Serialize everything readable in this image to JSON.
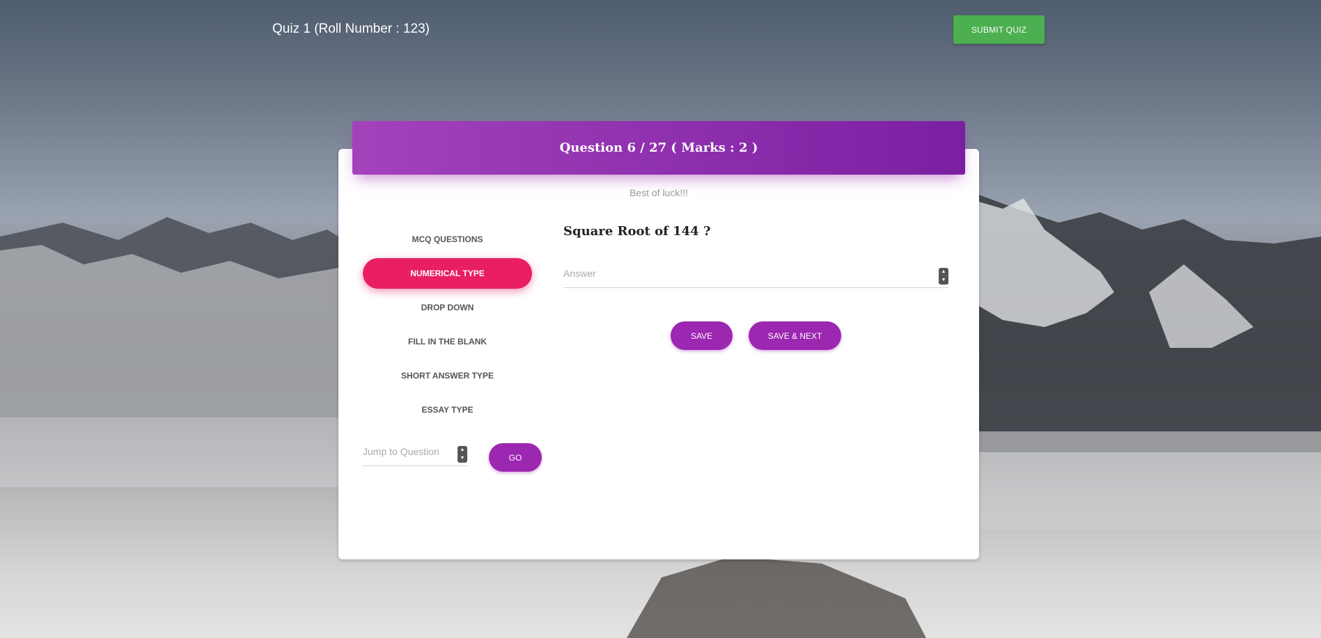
{
  "topbar": {
    "title": "Quiz 1 (Roll Number : 123)",
    "submit_label": "SUBMIT QUIZ"
  },
  "card": {
    "header": "Question 6 / 27 ( Marks : 2 )",
    "subtitle": "Best of luck!!!"
  },
  "nav": {
    "items": [
      {
        "label": "MCQ QUESTIONS",
        "active": false
      },
      {
        "label": "NUMERICAL TYPE",
        "active": true
      },
      {
        "label": "DROP DOWN",
        "active": false
      },
      {
        "label": "FILL IN THE BLANK",
        "active": false
      },
      {
        "label": "SHORT ANSWER TYPE",
        "active": false
      },
      {
        "label": "ESSAY TYPE",
        "active": false
      }
    ]
  },
  "jump": {
    "placeholder": "Jump to Question",
    "value": "",
    "go_label": "GO"
  },
  "question": {
    "text": "Square Root of 144 ?",
    "answer_placeholder": "Answer",
    "answer_value": ""
  },
  "actions": {
    "save_label": "SAVE",
    "save_next_label": "SAVE & NEXT"
  },
  "colors": {
    "header_start": "#a442bb",
    "header_end": "#7b1fa2",
    "active_tab": "#e91e63",
    "primary_button": "#9c27b0",
    "submit_button": "#4caf50"
  },
  "icons": {
    "spinner": "number-spinner-icon"
  }
}
